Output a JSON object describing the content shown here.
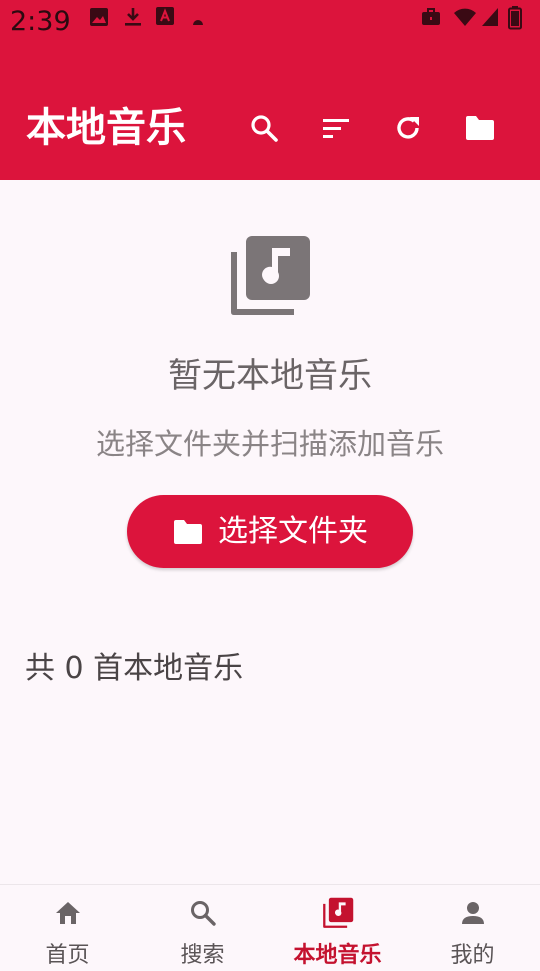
{
  "status_bar": {
    "time": "2:39",
    "left_icons": [
      "image-icon",
      "download-icon",
      "font-a-icon",
      "dot-icon"
    ],
    "right_icons": [
      "briefcase-icon",
      "wifi-icon",
      "signal-icon",
      "battery-icon"
    ]
  },
  "app_bar": {
    "title": "本地音乐",
    "actions": [
      "search-icon",
      "sort-icon",
      "refresh-icon",
      "folder-icon"
    ],
    "background": "#dc143c"
  },
  "empty_state": {
    "icon": "music-library-icon",
    "title": "暂无本地音乐",
    "subtitle": "选择文件夹并扫描添加音乐",
    "button_label": "选择文件夹",
    "button_icon": "folder-icon"
  },
  "count_text": "共 0 首本地音乐",
  "bottom_nav": {
    "items": [
      {
        "label": "首页",
        "icon": "home-icon",
        "active": false
      },
      {
        "label": "搜索",
        "icon": "search-icon",
        "active": false
      },
      {
        "label": "本地音乐",
        "icon": "music-library-icon",
        "active": true
      },
      {
        "label": "我的",
        "icon": "person-icon",
        "active": false
      }
    ]
  },
  "colors": {
    "accent": "#dc143c",
    "background": "#fdf7fb",
    "active_nav": "#c4122f"
  }
}
